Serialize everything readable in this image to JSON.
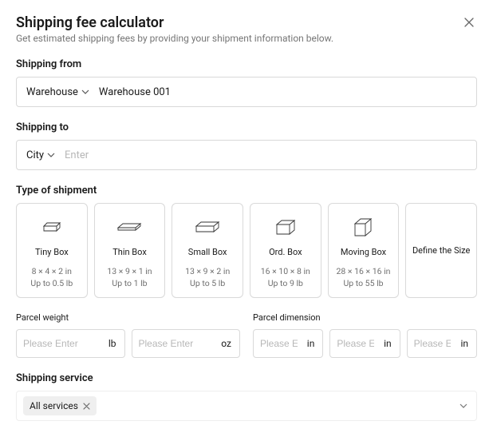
{
  "header": {
    "title": "Shipping fee calculator",
    "subtitle": "Get estimated shipping fees by providing your shipment information below."
  },
  "shipping_from": {
    "label": "Shipping from",
    "selector_label": "Warehouse",
    "value": "Warehouse 001"
  },
  "shipping_to": {
    "label": "Shipping to",
    "selector_label": "City",
    "placeholder": "Enter"
  },
  "type_of_shipment": {
    "label": "Type of shipment",
    "cards": [
      {
        "title": "Tiny Box",
        "dims": "8 × 4 × 2 in",
        "weight": "Up to 0.5 lb",
        "icon": "tiny"
      },
      {
        "title": "Thin Box",
        "dims": "13 × 9 × 1 in",
        "weight": "Up to 1 lb",
        "icon": "thin"
      },
      {
        "title": "Small Box",
        "dims": "13 × 9 × 2 in",
        "weight": "Up to 5 lb",
        "icon": "small"
      },
      {
        "title": "Ord. Box",
        "dims": "16 × 10 × 8 in",
        "weight": "Up to 9 lb",
        "icon": "ord"
      },
      {
        "title": "Moving Box",
        "dims": "28 × 16 × 16 in",
        "weight": "Up to 55 lb",
        "icon": "moving"
      }
    ],
    "define_label": "Define the Size"
  },
  "parcel_weight": {
    "label": "Parcel weight",
    "inputs": [
      {
        "placeholder": "Please Enter",
        "unit": "lb"
      },
      {
        "placeholder": "Please Enter",
        "unit": "oz"
      }
    ]
  },
  "parcel_dimension": {
    "label": "Parcel dimension",
    "inputs": [
      {
        "placeholder": "Please Enter",
        "unit": "in"
      },
      {
        "placeholder": "Please Enter",
        "unit": "in"
      },
      {
        "placeholder": "Please Enter",
        "unit": "in"
      }
    ]
  },
  "shipping_service": {
    "label": "Shipping service",
    "chip": "All services"
  }
}
